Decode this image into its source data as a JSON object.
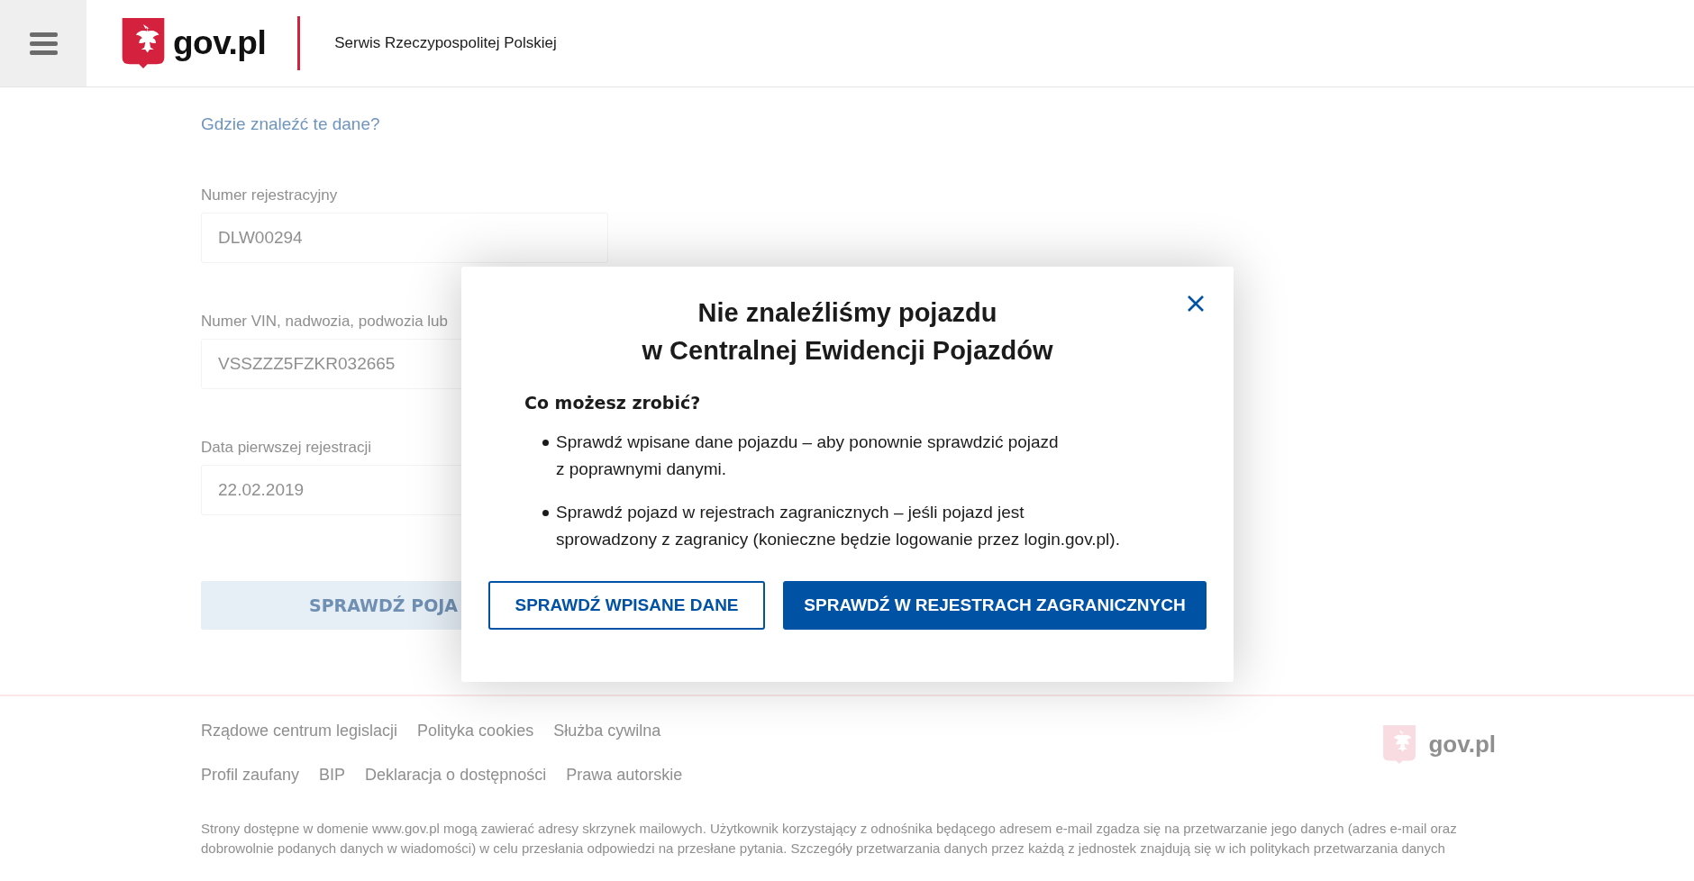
{
  "header": {
    "logo_text": "gov.pl",
    "tagline": "Serwis Rzeczypospolitej Polskiej"
  },
  "form": {
    "help_link": "Gdzie znaleźć te dane?",
    "fields": [
      {
        "label": "Numer rejestracyjny",
        "value": "DLW00294"
      },
      {
        "label": "Numer VIN, nadwozia, podwozia lub",
        "value": "VSSZZZ5FZKR032665"
      },
      {
        "label": "Data pierwszej rejestracji",
        "value": "22.02.2019"
      }
    ],
    "submit_button": "SPRAWDŹ POJA"
  },
  "modal": {
    "title": "Nie znaleźliśmy pojazdu\nw Centralnej Ewidencji Pojazdów",
    "subtitle": "Co możesz zrobić?",
    "items": [
      "Sprawdź wpisane dane pojazdu – aby ponownie sprawdzić pojazd\nz poprawnymi danymi.",
      "Sprawdź pojazd w rejestrach zagranicznych – jeśli pojazd jest\nsprowadzony z zagranicy (konieczne będzie logowanie przez login.gov.pl)."
    ],
    "buttons": [
      {
        "label": "SPRAWDŹ WPISANE DANE",
        "kind": "secondary"
      },
      {
        "label": "SPRAWDŹ W REJESTRACH ZAGRANICZNYCH",
        "kind": "primary"
      }
    ]
  },
  "footer": {
    "link_rows": [
      [
        "Rządowe centrum legislacji",
        "Polityka cookies",
        "Służba cywilna"
      ],
      [
        "Profil zaufany",
        "BIP",
        "Deklaracja o dostępności",
        "Prawa autorskie"
      ]
    ],
    "logo_text": "gov.pl",
    "notice": "Strony dostępne w domenie www.gov.pl mogą zawierać adresy skrzynek mailowych. Użytkownik korzystający z odnośnika będącego adresem e-mail zgadza się na przetwarzanie jego danych (adres e-mail oraz dobrowolnie podanych danych w wiadomości) w celu przesłania odpowiedzi na przesłane pytania. Szczegóły przetwarzania danych przez każdą z jednostek znajdują się w ich politykach przetwarzania danych"
  }
}
